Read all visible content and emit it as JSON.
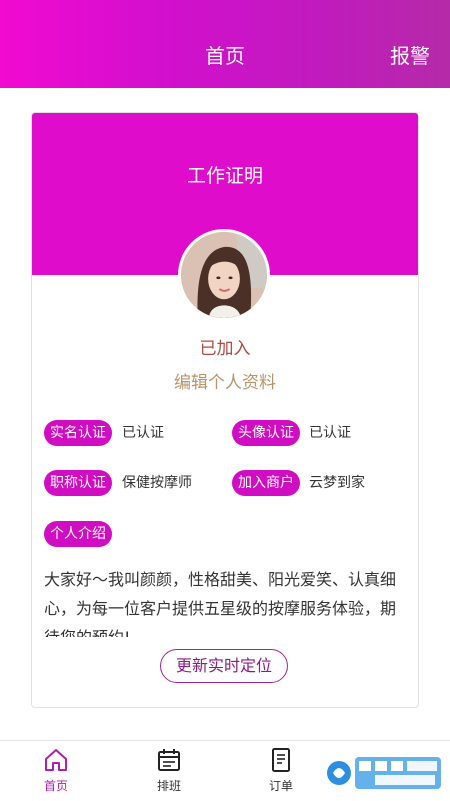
{
  "header": {
    "title": "首页",
    "report_label": "报警"
  },
  "card": {
    "banner_title": "工作证明",
    "status": "已加入",
    "edit_profile_label": "编辑个人资料",
    "fields": [
      {
        "label": "实名认证",
        "value": "已认证"
      },
      {
        "label": "头像认证",
        "value": "已认证"
      },
      {
        "label": "职称认证",
        "value": "保健按摩师"
      },
      {
        "label": "加入商户",
        "value": "云梦到家"
      }
    ],
    "intro_label": "个人介绍",
    "intro_text": "大家好～我叫颜颜，性格甜美、阳光爱笑、认真细心，为每一位客户提供五星级的按摩服务体验，期待您的预约!",
    "locate_button_label": "更新实时定位"
  },
  "tabbar": {
    "items": [
      {
        "label": "首页",
        "icon": "home-icon",
        "active": true
      },
      {
        "label": "排班",
        "icon": "calendar-icon",
        "active": false
      },
      {
        "label": "订单",
        "icon": "order-icon",
        "active": false
      }
    ]
  },
  "colors": {
    "brand": "#e00ccb",
    "tag": "#d10dc4",
    "status": "#b04b45",
    "edit": "#b8946a",
    "active_tab": "#b01fae"
  }
}
